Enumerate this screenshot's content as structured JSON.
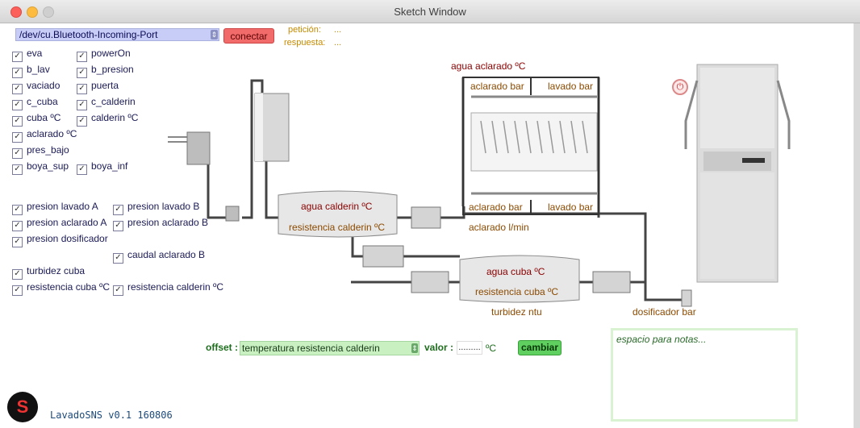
{
  "window": {
    "title": "Sketch Window"
  },
  "serial": {
    "port": "/dev/cu.Bluetooth-Incoming-Port",
    "connect_label": "conectar"
  },
  "comm": {
    "request_label": "petición:",
    "request_value": "...",
    "response_label": "respuesta:",
    "response_value": "..."
  },
  "checks_left": [
    "eva",
    "b_lav",
    "vaciado",
    "c_cuba",
    "cuba ºC",
    "aclarado ºC",
    "pres_bajo",
    "boya_sup"
  ],
  "checks_right": [
    "powerOn",
    "b_presion",
    "puerta",
    "c_calderin",
    "calderin ºC",
    "boya_inf"
  ],
  "checks_press": {
    "a": [
      "presion lavado A",
      "presion aclarado A",
      "presion dosificador"
    ],
    "b": [
      "presion lavado B",
      "presion aclarado B"
    ],
    "caudal": "caudal aclarado B",
    "turbidez": "turbidez cuba",
    "res_cuba": "resistencia cuba ºC",
    "res_cald": "resistencia calderin ºC"
  },
  "diagram": {
    "agua_aclarado": "agua aclarado ºC",
    "aclarado_bar_top": "aclarado bar",
    "lavado_bar_top": "lavado bar",
    "aclarado_bar_bot": "aclarado bar",
    "lavado_bar_bot": "lavado bar",
    "aclarado_lmin": "aclarado l/min",
    "agua_calderin": "agua calderin ºC",
    "resistencia_calderin": "resistencia calderin ºC",
    "agua_cuba": "agua cuba ºC",
    "resistencia_cuba": "resistencia cuba ºC",
    "turbidez": "turbidez ntu",
    "dosificador": "dosificador bar"
  },
  "offset": {
    "label": "offset :",
    "selected": "temperatura resistencia calderin",
    "valor_label": "valor :",
    "valor_value": ".........",
    "unit": "ºC",
    "button": "cambiar"
  },
  "notes": {
    "placeholder": "espacio para notas..."
  },
  "footer": {
    "version": "LavadoSNS  v0.1   160806"
  },
  "colors": {
    "accent_red": "#f26b6b",
    "accent_green": "#5fcf5f",
    "label_brown": "#8b4a00"
  }
}
